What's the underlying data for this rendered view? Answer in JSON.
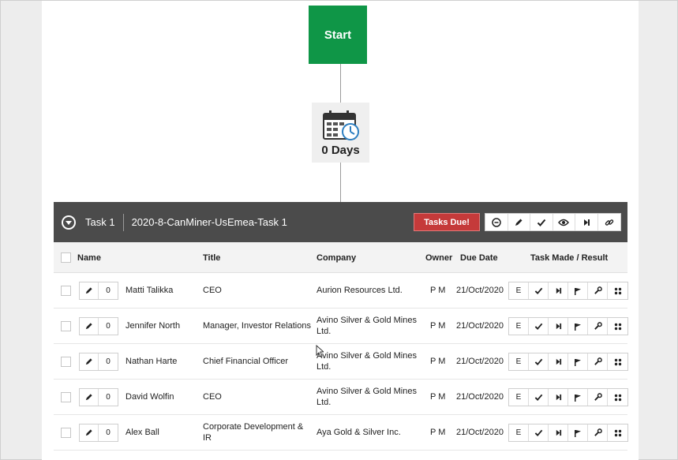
{
  "workflow": {
    "start_label": "Start",
    "delay_label": "0 Days"
  },
  "task": {
    "number_label": "Task 1",
    "name": "2020-8-CanMiner-UsEmea-Task 1",
    "due_button": "Tasks Due!"
  },
  "columns": {
    "name": "Name",
    "title": "Title",
    "company": "Company",
    "owner": "Owner",
    "due_date": "Due Date",
    "task_result": "Task Made / Result"
  },
  "rows": [
    {
      "count": "0",
      "name": "Matti Talikka",
      "title": "CEO",
      "company": "Aurion Resources Ltd.",
      "owner": "P M",
      "due": "21/Oct/2020",
      "e_label": "E"
    },
    {
      "count": "0",
      "name": "Jennifer North",
      "title": "Manager, Investor Relations",
      "company": "Avino Silver & Gold Mines Ltd.",
      "owner": "P M",
      "due": "21/Oct/2020",
      "e_label": "E"
    },
    {
      "count": "0",
      "name": "Nathan Harte",
      "title": "Chief Financial Officer",
      "company": "Avino Silver & Gold Mines Ltd.",
      "owner": "P M",
      "due": "21/Oct/2020",
      "e_label": "E"
    },
    {
      "count": "0",
      "name": "David Wolfin",
      "title": "CEO",
      "company": "Avino Silver & Gold Mines Ltd.",
      "owner": "P M",
      "due": "21/Oct/2020",
      "e_label": "E"
    },
    {
      "count": "0",
      "name": "Alex Ball",
      "title": "Corporate Development & IR",
      "company": "Aya Gold & Silver Inc.",
      "owner": "P M",
      "due": "21/Oct/2020",
      "e_label": "E"
    }
  ],
  "colors": {
    "start_green": "#0f9647",
    "header_dark": "#4b4b4b",
    "due_red": "#c53a3a"
  }
}
